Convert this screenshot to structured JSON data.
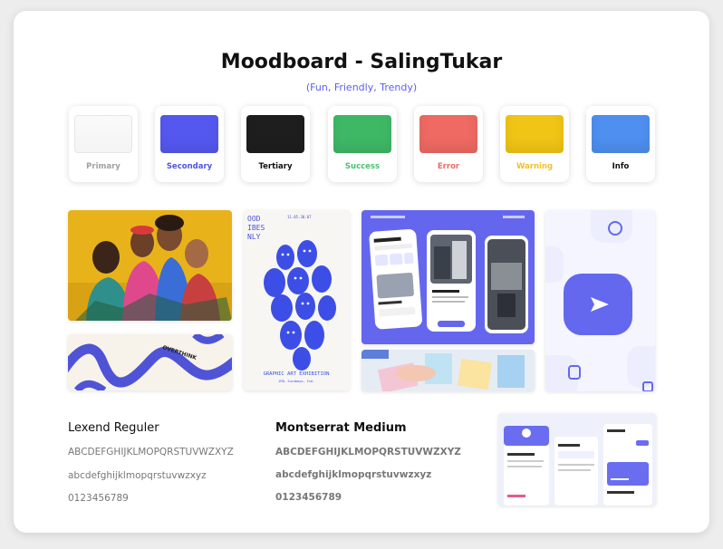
{
  "header": {
    "title": "Moodboard - SalingTukar",
    "subtitle": "(Fun, Friendly, Trendy)",
    "subtitle_color": "#5a5ff2"
  },
  "swatches": [
    {
      "label": "Primary",
      "color": "#f4f4f4",
      "text_color": "#a0a0a0"
    },
    {
      "label": "Secondary",
      "color": "#5558ef",
      "text_color": "#4f52e8"
    },
    {
      "label": "Tertiary",
      "color": "#1e1e1e",
      "text_color": "#111111"
    },
    {
      "label": "Success",
      "color": "#3fb866",
      "text_color": "#4cbf72"
    },
    {
      "label": "Error",
      "color": "#ee6a62",
      "text_color": "#ec6d66"
    },
    {
      "label": "Warning",
      "color": "#f1c516",
      "text_color": "#f2c02a"
    },
    {
      "label": "Info",
      "color": "#4f8ff0",
      "text_color": "#111111"
    }
  ],
  "images": {
    "poster": {
      "top_left": "OOD\nIBES\nNLY",
      "top_right": "11.05.30.07",
      "caption": "GRAPHIC ART EXHIBITION",
      "footer": "1FOL  Surabaya, Ind."
    },
    "pattern_text": "OVERTHINK",
    "app_mockup": {
      "greeting": "Hello, Manak!",
      "section": "Popular",
      "detail": "Prout Palace"
    }
  },
  "typography": {
    "lexend": {
      "name": "Lexend Reguler",
      "upper": "ABCDEFGHIJKLMOPQRSTUVWZXYZ",
      "lower": "abcdefghijklmopqrstuvwzxyz",
      "digits": "0123456789"
    },
    "montserrat": {
      "name": "Montserrat Medium",
      "upper": "ABCDEFGHIJKLMOPQRSTUVWZXYZ",
      "lower": "abcdefghijklmopqrstuvwzxyz",
      "digits": "0123456789"
    }
  }
}
